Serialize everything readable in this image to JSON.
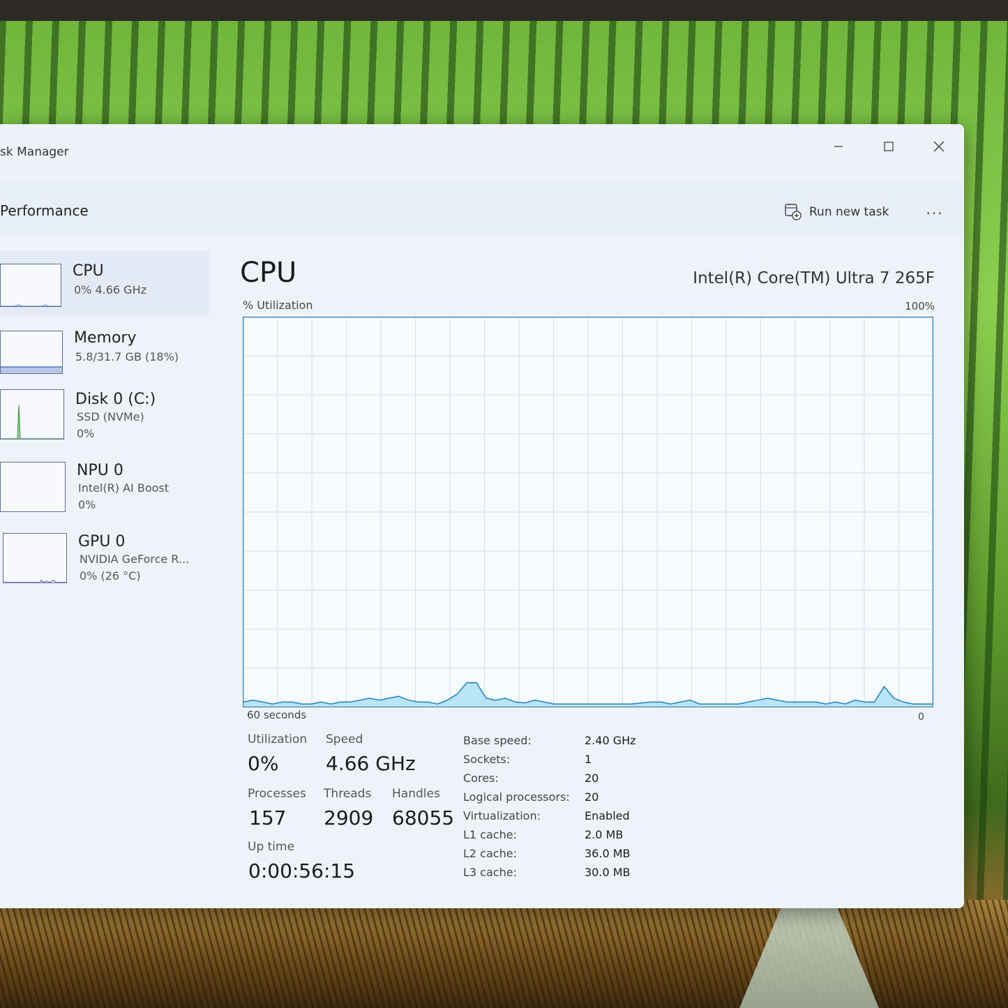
{
  "window": {
    "title": "sk Manager"
  },
  "header": {
    "page_title": "Performance",
    "run_task_label": "Run new task",
    "more_label": "..."
  },
  "sidebar": {
    "items": [
      {
        "name": "CPU",
        "sub1": "0%  4.66 GHz",
        "sub2": ""
      },
      {
        "name": "Memory",
        "sub1": "5.8/31.7 GB (18%)",
        "sub2": ""
      },
      {
        "name": "Disk 0 (C:)",
        "sub1": "SSD (NVMe)",
        "sub2": "0%"
      },
      {
        "name": "NPU 0",
        "sub1": "Intel(R) AI Boost",
        "sub2": "0%"
      },
      {
        "name": "GPU 0",
        "sub1": "NVIDIA GeForce R...",
        "sub2": "0%  (26 °C)"
      }
    ]
  },
  "main": {
    "title": "CPU",
    "model": "Intel(R) Core(TM) Ultra 7 265F",
    "util_label": "% Utilization",
    "max_label": "100%",
    "time_label": "60 seconds",
    "zero_label": "0",
    "stats": {
      "utilization_label": "Utilization",
      "utilization": "0%",
      "speed_label": "Speed",
      "speed": "4.66 GHz",
      "processes_label": "Processes",
      "processes": "157",
      "threads_label": "Threads",
      "threads": "2909",
      "handles_label": "Handles",
      "handles": "68055",
      "uptime_label": "Up time",
      "uptime": "0:00:56:15"
    },
    "specs": [
      {
        "key": "Base speed:",
        "value": "2.40 GHz"
      },
      {
        "key": "Sockets:",
        "value": "1"
      },
      {
        "key": "Cores:",
        "value": "20"
      },
      {
        "key": "Logical processors:",
        "value": "20"
      },
      {
        "key": "Virtualization:",
        "value": "Enabled"
      },
      {
        "key": "L1 cache:",
        "value": "2.0 MB"
      },
      {
        "key": "L2 cache:",
        "value": "36.0 MB"
      },
      {
        "key": "L3 cache:",
        "value": "30.0 MB"
      }
    ]
  },
  "cpu_history_percent": [
    1,
    1.5,
    1,
    0.5,
    1,
    1,
    0.5,
    0.5,
    1,
    0.5,
    1,
    1,
    1.5,
    2,
    1.5,
    2,
    2.5,
    1.5,
    1,
    1,
    0.5,
    1.5,
    3,
    6,
    6,
    2,
    1.5,
    2,
    1,
    0.8,
    1.5,
    1,
    0.5,
    0.5,
    0.5,
    0.5,
    0.5,
    0.5,
    0.5,
    0.5,
    0.5,
    0.8,
    1,
    1,
    0.5,
    1,
    1.5,
    0.5,
    0.5,
    0.5,
    0.5,
    0.5,
    1,
    1.5,
    2,
    1.5,
    1,
    1,
    1,
    1,
    0.5,
    1,
    0.5,
    1.5,
    1,
    1,
    5,
    2,
    1,
    0.5,
    0.5,
    0.5
  ],
  "colors": {
    "accent": "#1f7fc7",
    "graph_fill": "#aee1f5",
    "graph_grid": "#c8dff0",
    "graph_border": "#2b78b8"
  }
}
